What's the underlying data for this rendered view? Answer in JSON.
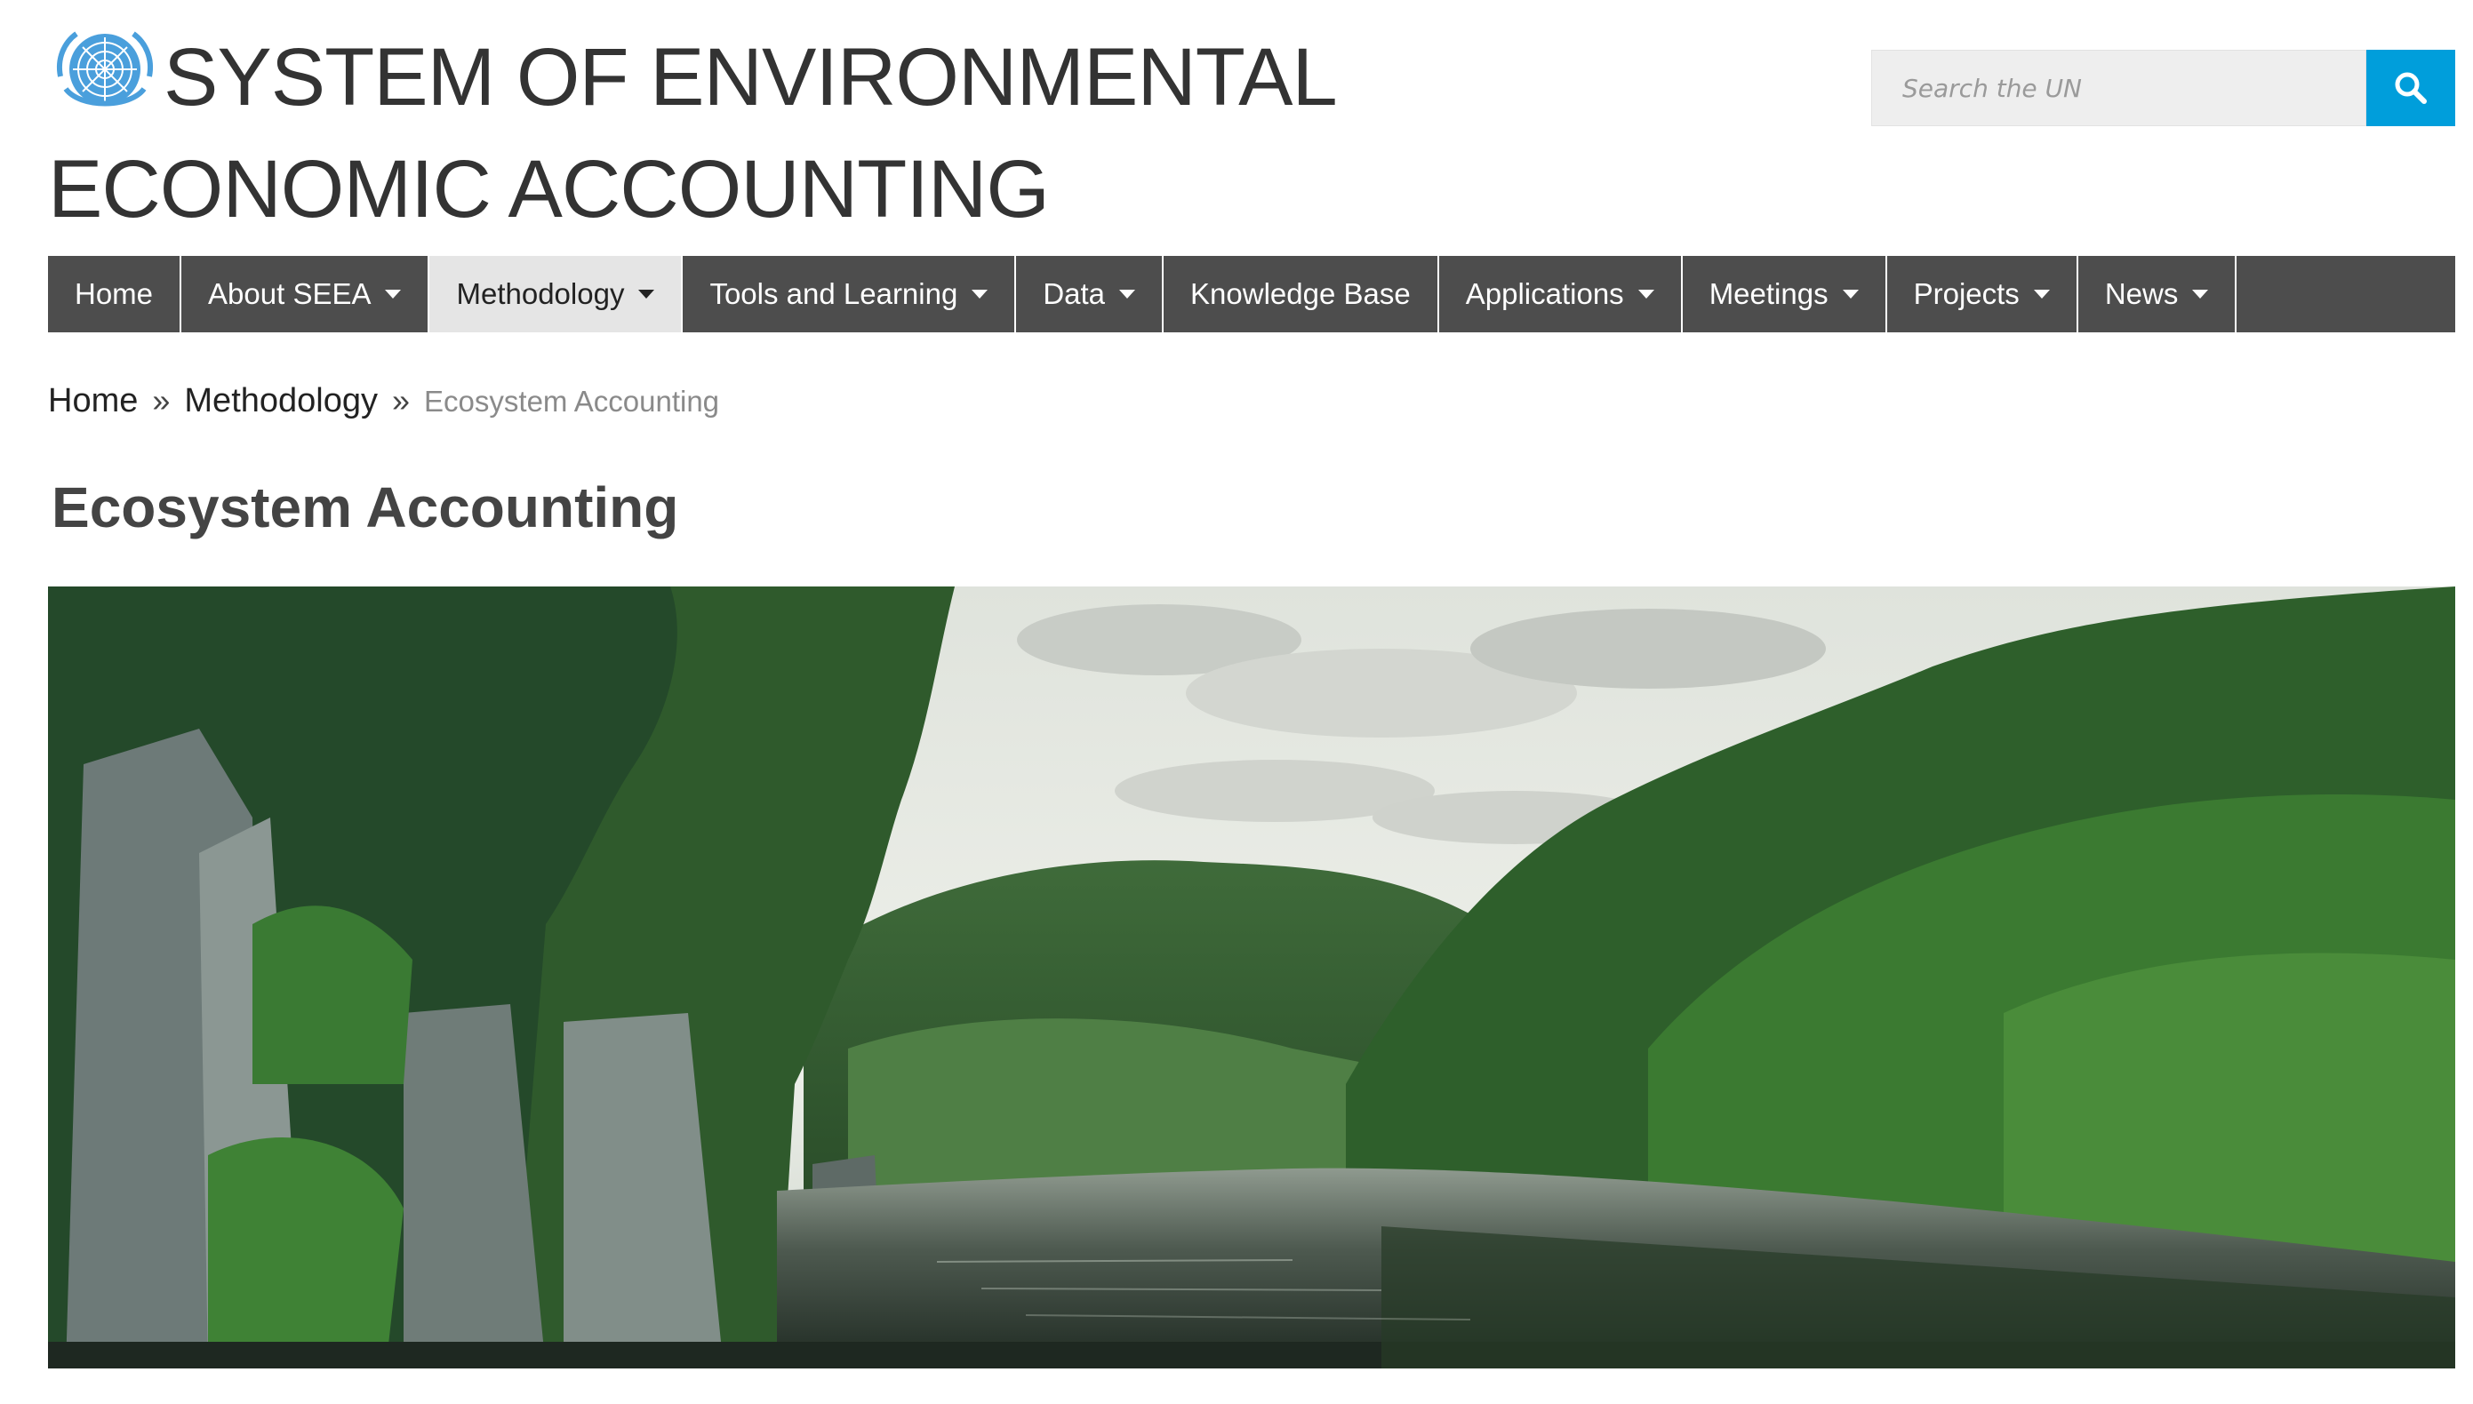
{
  "header": {
    "logo_icon": "un-emblem-icon",
    "site_title": "SYSTEM OF ENVIRONMENTAL ECONOMIC ACCOUNTING",
    "search_placeholder": "Search the UN",
    "search_icon": "search-icon",
    "accent_color": "#009edb"
  },
  "nav": {
    "items": [
      {
        "label": "Home",
        "has_dropdown": false,
        "active": false
      },
      {
        "label": "About SEEA",
        "has_dropdown": true,
        "active": false
      },
      {
        "label": "Methodology",
        "has_dropdown": true,
        "active": true
      },
      {
        "label": "Tools and Learning",
        "has_dropdown": true,
        "active": false
      },
      {
        "label": "Data",
        "has_dropdown": true,
        "active": false
      },
      {
        "label": "Knowledge Base",
        "has_dropdown": false,
        "active": false
      },
      {
        "label": "Applications",
        "has_dropdown": true,
        "active": false
      },
      {
        "label": "Meetings",
        "has_dropdown": true,
        "active": false
      },
      {
        "label": "Projects",
        "has_dropdown": true,
        "active": false
      },
      {
        "label": "News",
        "has_dropdown": true,
        "active": false
      }
    ],
    "background_color": "#4d4d4d",
    "active_background_color": "#e5e5e5"
  },
  "breadcrumb": {
    "items": [
      "Home",
      "Methodology"
    ],
    "separator": "»",
    "current": "Ecosystem Accounting"
  },
  "page": {
    "title": "Ecosystem Accounting"
  },
  "hero_image": {
    "subject": "river-landscape"
  }
}
